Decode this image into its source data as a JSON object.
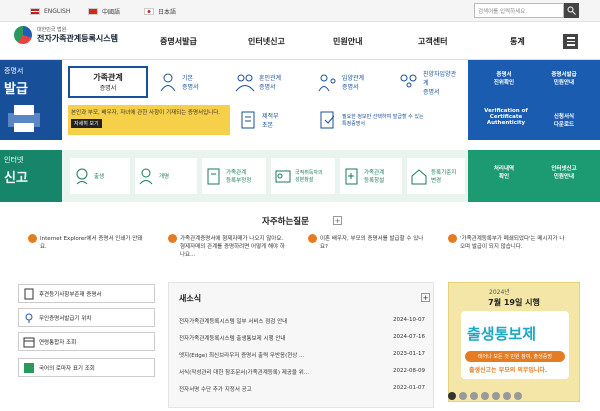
{
  "topbar": {
    "langs": [
      "ENGLISH",
      "中國語",
      "日本語"
    ],
    "search_placeholder": "검색어를 입력하세요."
  },
  "header": {
    "logo_sub": "대법원 전자가족관계등록시스템",
    "logo_sub_short": "대한민국 법원",
    "logo_title": "전자가족관계등록시스템",
    "nav": [
      "증명서발급",
      "인터넷신고",
      "민원안내",
      "고객센터",
      "통계"
    ]
  },
  "sec1": {
    "en": "증명서",
    "label": "발급",
    "active_card": {
      "title": "가족관계",
      "sub": "증명서"
    },
    "cards": [
      "기본\n증명서",
      "혼인관계\n증명서",
      "입양관계\n증명서",
      "친양자입양관계\n증명서",
      "제적부\n초본",
      "필요한 정보만 선택하여 발급할 수 있는\n특정증명서"
    ],
    "note_text": "본인과 부모, 배우자, 자녀에 관한 사항이 기재되는 증명서입니다.",
    "note_btn": "자세히 보기",
    "right_links": [
      "증명서\n진위확인",
      "증명서발급\n민원안내",
      "Verification of\nCertificate\nAuthenticity",
      "신청서식\n다운로드"
    ]
  },
  "sec2": {
    "en": "인터넷",
    "label": "신고",
    "cards": [
      "출생",
      "개명",
      "가족관계\n등록부정정",
      "국적취득자의\n성본창설",
      "가족관계\n등록창설",
      "등록기준지\n변경"
    ],
    "right_links": [
      "처리내역\n확인",
      "인터넷신고\n민원안내"
    ]
  },
  "faq": {
    "title": "자주하는질문",
    "items": [
      "Internet Explorer에서 증명서 인쇄가 안돼요.",
      "가족관계증명서에 형제자매가 나오지 않아요. 형제자매의 관계를 증명하려면 어떻게 해야 하나요...",
      "이혼 배우자, 부모의 증명서를 발급할 수 있나요?",
      "'가족관계등록부가 폐쇄되었다'는 메시지가 나오며 발급이 되지 않습니다."
    ]
  },
  "quick": [
    "후견등기사항부존재 증명서",
    "무인증명서발급기 위치",
    "연령통합자 조회",
    "국어의 로마자 표기 조회"
  ],
  "news": {
    "title": "새소식",
    "items": [
      {
        "title": "전자가족관계등록시스템 일부 서비스 점검 안내",
        "date": "2024-10-07"
      },
      {
        "title": "전자가족관계등록시스템 출생통보제 시행 안내",
        "date": "2024-07-16"
      },
      {
        "title": "엣지(Edge) 최신브라우저 증명서 출력 무반응(현상 ...",
        "date": "2023-01-17"
      },
      {
        "title": "서식(작성관리 대한 참조문서(가족관계등록) 제공을 위...",
        "date": "2022-08-09"
      },
      {
        "title": "전자서명 수단 추가 지정서 공고",
        "date": "2022-01-07"
      }
    ]
  },
  "banner": {
    "top": "2024년",
    "date": "7월 19일 시행",
    "headline": "출생통보제",
    "sub": "태어나 모든 것 민원 참여, 출생증명",
    "bottom": "출생신고는 부모의 의무입니다."
  },
  "colors": {
    "blue": "#1a5cb0",
    "green": "#1c9a72",
    "yellow": "#f7d04a"
  }
}
